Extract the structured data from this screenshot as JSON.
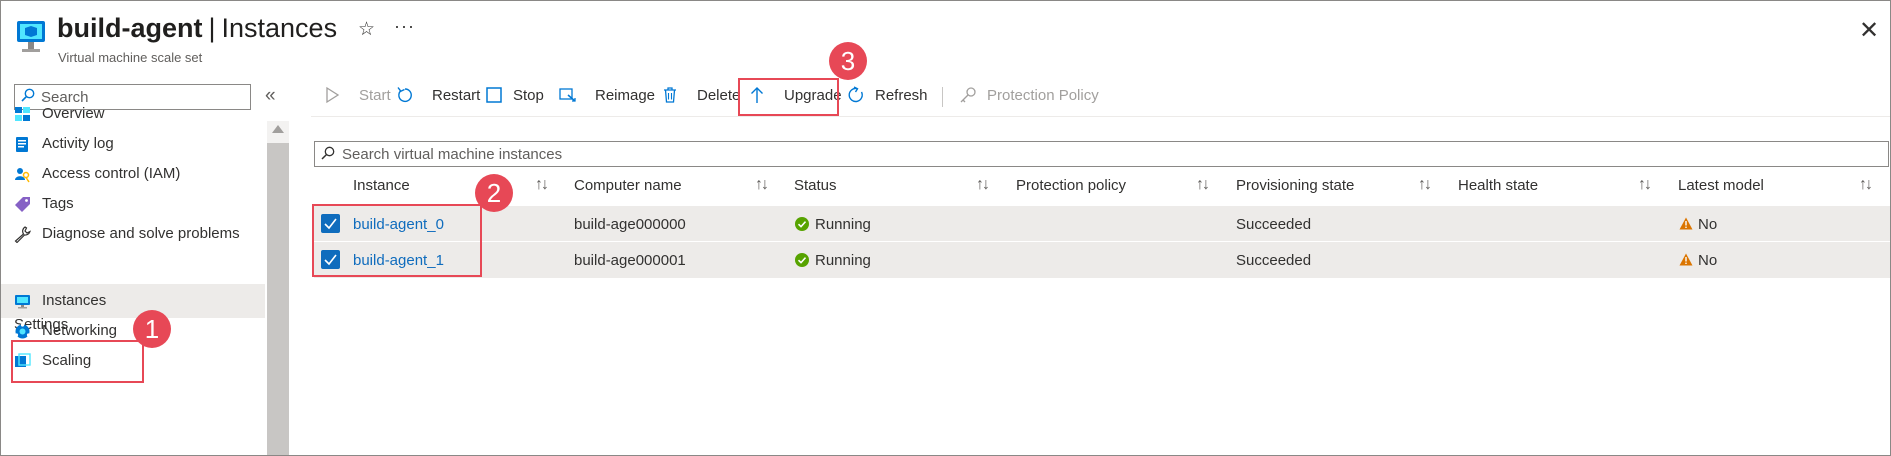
{
  "header": {
    "resource_name": "build-agent",
    "separator": "|",
    "blade_title": "Instances",
    "subtitle": "Virtual machine scale set",
    "icons": [
      "vm-scale-set-icon",
      "star-icon",
      "more-icon",
      "close-icon"
    ],
    "more_glyph": "···",
    "close_glyph": "✕",
    "star_glyph": "☆"
  },
  "sidebar": {
    "search_placeholder": "Search",
    "collapse_glyph": "«",
    "items": [
      {
        "label": "Overview",
        "icon": "overview-icon"
      },
      {
        "label": "Activity log",
        "icon": "activity-log-icon"
      },
      {
        "label": "Access control (IAM)",
        "icon": "iam-icon"
      },
      {
        "label": "Tags",
        "icon": "tag-icon"
      },
      {
        "label": "Diagnose and solve problems",
        "icon": "wrench-icon"
      }
    ],
    "settings_header": "Settings",
    "settings_items": [
      {
        "label": "Instances",
        "icon": "instances-icon",
        "active": true
      },
      {
        "label": "Networking",
        "icon": "networking-icon"
      },
      {
        "label": "Scaling",
        "icon": "scaling-icon"
      }
    ]
  },
  "toolbar": {
    "buttons": [
      {
        "label": "Start",
        "icon": "play-icon",
        "disabled": true
      },
      {
        "label": "Restart",
        "icon": "restart-icon"
      },
      {
        "label": "Stop",
        "icon": "stop-icon"
      },
      {
        "label": "Reimage",
        "icon": "reimage-icon"
      },
      {
        "label": "Delete",
        "icon": "delete-icon"
      },
      {
        "label": "Upgrade",
        "icon": "upgrade-icon"
      },
      {
        "label": "Refresh",
        "icon": "refresh-icon"
      },
      {
        "label": "Protection Policy",
        "icon": "key-icon",
        "disabled": true
      }
    ]
  },
  "grid": {
    "search_placeholder": "Search virtual machine instances",
    "columns": [
      "Instance",
      "Computer name",
      "Status",
      "Protection policy",
      "Provisioning state",
      "Health state",
      "Latest model"
    ],
    "sort_glyph": "↑↓",
    "rows": [
      {
        "instance": "build-agent_0",
        "computer_name": "build-age000000",
        "status": "Running",
        "protection_policy": "",
        "provisioning_state": "Succeeded",
        "health_state": "",
        "latest_model": "No",
        "selected": true
      },
      {
        "instance": "build-agent_1",
        "computer_name": "build-age000001",
        "status": "Running",
        "protection_policy": "",
        "provisioning_state": "Succeeded",
        "health_state": "",
        "latest_model": "No",
        "selected": true
      }
    ]
  },
  "callouts": [
    "1",
    "2",
    "3"
  ],
  "colors": {
    "accent": "#0f6cbd",
    "callout": "#e74856",
    "success": "#57a300",
    "warning": "#db7500"
  }
}
